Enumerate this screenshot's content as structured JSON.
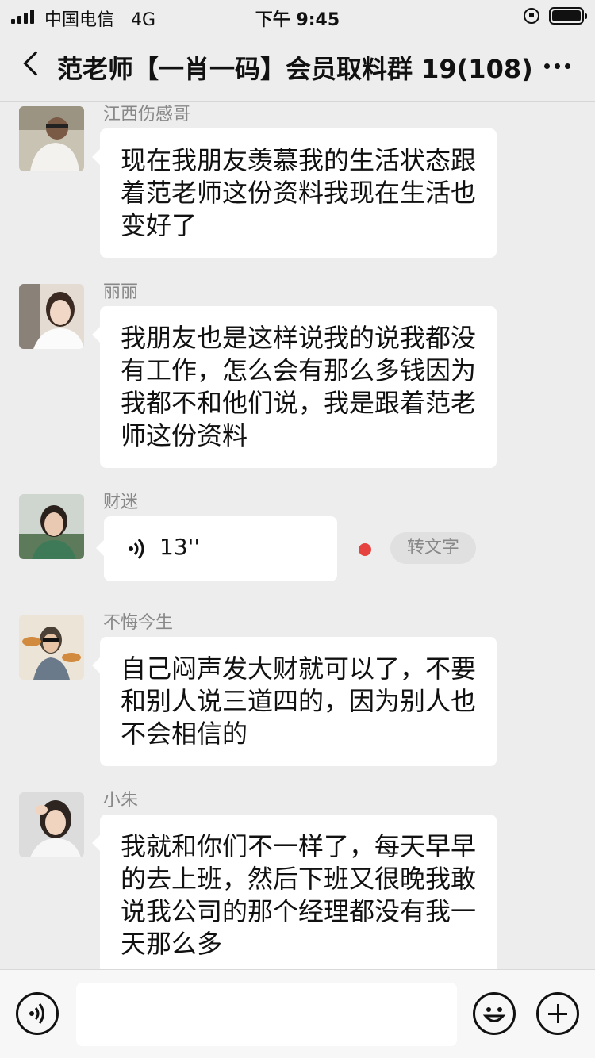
{
  "status_bar": {
    "carrier": "中国电信",
    "network": "4G",
    "time": "下午 9:45"
  },
  "nav": {
    "title": "范老师【一肖一码】会员取料群 19(108)"
  },
  "messages": [
    {
      "sender": "江西伤感哥",
      "text": "现在我朋友羡慕我的生活状态跟着范老师这份资料我现在生活也变好了"
    },
    {
      "sender": "丽丽",
      "text": "我朋友也是这样说我的说我都没有工作，怎么会有那么多钱因为我都不和他们说，我是跟着范老师这份资料"
    },
    {
      "sender": "财迷",
      "voice_duration": "13''",
      "to_text_label": "转文字"
    },
    {
      "sender": "不悔今生",
      "text": "自己闷声发大财就可以了，不要和别人说三道四的，因为别人也不会相信的"
    },
    {
      "sender": "小朱",
      "text": "我就和你们不一样了，每天早早的去上班，然后下班又很晚我敢说我公司的那个经理都没有我一天那么多"
    }
  ],
  "colors": {
    "background": "#ededed",
    "bubble": "#ffffff",
    "unread_dot": "#e64340"
  }
}
